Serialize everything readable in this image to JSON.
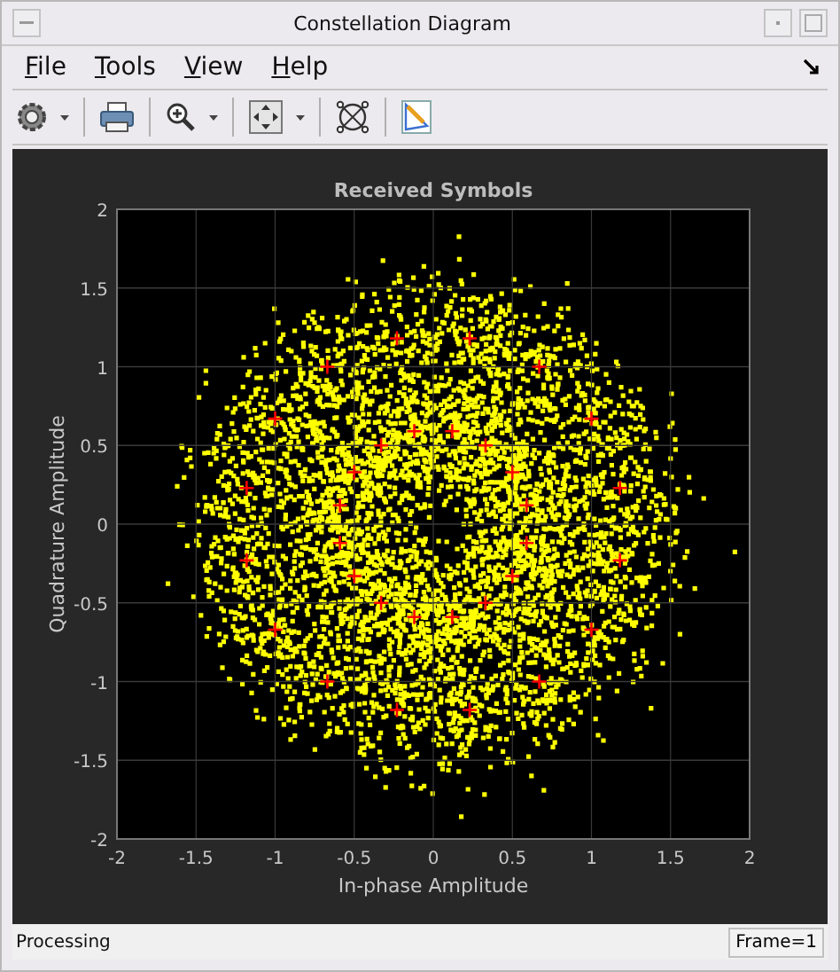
{
  "window": {
    "title": "Constellation Diagram"
  },
  "menu": [
    "File",
    "Tools",
    "View",
    "Help"
  ],
  "plot": {
    "chart_data": {
      "type": "scatter",
      "title": "Received Symbols",
      "xlabel": "In-phase Amplitude",
      "ylabel": "Quadrature Amplitude",
      "grid": true,
      "xlim": [
        -2,
        2
      ],
      "ylim": [
        -2,
        2
      ],
      "xticks": [
        -2,
        -1.5,
        -1,
        -0.5,
        0,
        0.5,
        1,
        1.5,
        2
      ],
      "yticks": [
        -2,
        -1.5,
        -1,
        -0.5,
        0,
        0.5,
        1,
        1.5,
        2
      ],
      "x": [
        0.59,
        0.5,
        0.33,
        0.12,
        -0.12,
        -0.33,
        -0.5,
        -0.59,
        -0.59,
        -0.5,
        -0.33,
        -0.12,
        0.12,
        0.33,
        0.5,
        0.59,
        1.18,
        1.0,
        0.67,
        0.23,
        -0.23,
        -0.67,
        -1.0,
        -1.18,
        -1.18,
        -1.0,
        -0.67,
        -0.23,
        0.23,
        0.67,
        1.0,
        1.18
      ],
      "series": [
        {
          "color": "#ff0000",
          "values": [
            0.12,
            0.33,
            0.5,
            0.59,
            0.59,
            0.5,
            0.33,
            0.12,
            -0.12,
            -0.33,
            -0.5,
            -0.59,
            -0.59,
            -0.5,
            -0.33,
            -0.12,
            0.23,
            0.67,
            1.0,
            1.18,
            1.18,
            1.0,
            0.67,
            0.23,
            -0.23,
            -0.67,
            -1.0,
            -1.18,
            -1.18,
            -1.0,
            -0.67,
            -0.23
          ]
        }
      ]
    }
  },
  "status_bar": {
    "text": "Processing",
    "frame": "Frame=1"
  }
}
